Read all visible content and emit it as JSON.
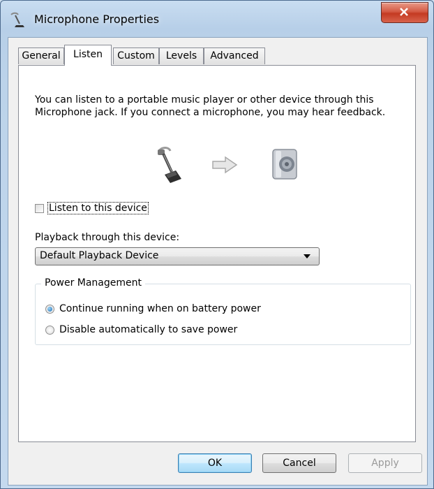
{
  "window": {
    "title": "Microphone Properties",
    "close_icon": "close-icon",
    "title_icon": "microphone-icon"
  },
  "tabs": [
    {
      "label": "General",
      "active": false
    },
    {
      "label": "Listen",
      "active": true
    },
    {
      "label": "Custom",
      "active": false
    },
    {
      "label": "Levels",
      "active": false
    },
    {
      "label": "Advanced",
      "active": false
    }
  ],
  "listen": {
    "description": "You can listen to a portable music player or other device through this Microphone jack.  If you connect a microphone, you may hear feedback.",
    "icons": [
      "microphone-icon",
      "arrow-right-icon",
      "speaker-icon"
    ],
    "listen_checkbox": {
      "label": "Listen to this device",
      "checked": false
    },
    "playback_label": "Playback through this device:",
    "playback_select": {
      "value": "Default Playback Device"
    },
    "power_management": {
      "title": "Power Management",
      "options": [
        {
          "label": "Continue running when on battery power",
          "selected": true
        },
        {
          "label": "Disable automatically to save power",
          "selected": false
        }
      ]
    }
  },
  "buttons": {
    "ok": "OK",
    "cancel": "Cancel",
    "apply": "Apply",
    "apply_disabled": true
  },
  "colors": {
    "close_button": "#c43a22",
    "default_button": "#3c7fb1",
    "radio_selected": "#1b6fb5"
  }
}
